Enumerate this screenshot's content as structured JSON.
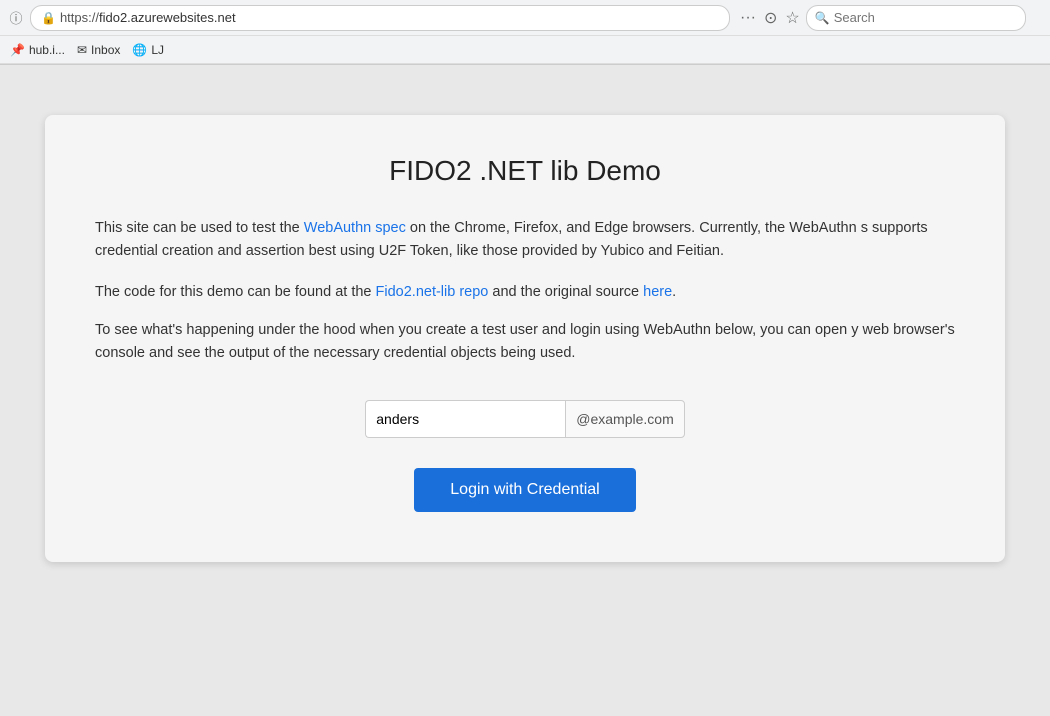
{
  "browser": {
    "url_protocol": "https://",
    "url_host": "fido2.azurewebsites.net",
    "menu_dots": "···",
    "reader_icon": "⊙",
    "bookmark_icon": "☆",
    "search_placeholder": "Search",
    "bookmarks": [
      {
        "label": "hub.i...",
        "icon": "📌"
      },
      {
        "label": "Inbox",
        "icon": "✉"
      },
      {
        "label": "LJ",
        "icon": "🌐"
      }
    ]
  },
  "page": {
    "title": "FIDO2 .NET lib Demo",
    "paragraph1_before_link1": "This site can be used to test the ",
    "link1_text": "WebAuthn spec",
    "link1_href": "#",
    "paragraph1_after_link1": " on the Chrome, Firefox, and Edge browsers. Currently, the WebAuthn s supports credential creation and assertion best using U2F Token, like those provided by Yubico and Feitian.",
    "paragraph2_before_link1": "The code for this demo can be found at the ",
    "link2_text": "Fido2.net-lib repo",
    "link2_href": "#",
    "paragraph2_middle": " and the original source ",
    "link3_text": "here",
    "link3_href": "#",
    "paragraph2_end": ".",
    "paragraph3": "To see what's happening under the hood when you create a test user and login using WebAuthn below, you can open y web browser's console and see the output of the necessary credential objects being used.",
    "input_value": "anders",
    "input_placeholder": "",
    "email_suffix": "@example.com",
    "login_button_label": "Login with Credential"
  }
}
